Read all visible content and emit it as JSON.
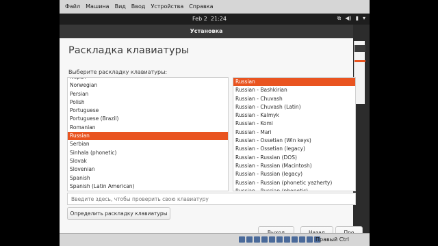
{
  "vbox_menu": [
    "Файл",
    "Машина",
    "Вид",
    "Ввод",
    "Устройства",
    "Справка"
  ],
  "topbar": {
    "date": "Feb 2",
    "time": "21:24",
    "tray_icons": [
      "network-icon",
      "volume-icon",
      "battery-icon",
      "menu-arrow-icon"
    ]
  },
  "window": {
    "title": "Установка"
  },
  "page": {
    "title": "Раскладка клавиатуры",
    "list_label": "Выберите раскладку клавиатуры:"
  },
  "layouts": [
    "Nepali",
    "Norwegian",
    "Persian",
    "Polish",
    "Portuguese",
    "Portuguese (Brazil)",
    "Romanian",
    "Russian",
    "Serbian",
    "Sinhala (phonetic)",
    "Slovak",
    "Slovenian",
    "Spanish",
    "Spanish (Latin American)"
  ],
  "layouts_selected": "Russian",
  "variants": [
    "Russian",
    "Russian - Bashkirian",
    "Russian - Chuvash",
    "Russian - Chuvash (Latin)",
    "Russian - Kalmyk",
    "Russian - Komi",
    "Russian - Mari",
    "Russian - Ossetian (Win keys)",
    "Russian - Ossetian (legacy)",
    "Russian - Russian (DOS)",
    "Russian - Russian (Macintosh)",
    "Russian - Russian (legacy)",
    "Russian - Russian (phonetic yazherty)",
    "Russian - Russian (phonetic)"
  ],
  "variants_selected": "Russian",
  "test_input": {
    "placeholder": "Введите здесь, чтобы проверить свою клавиатуру"
  },
  "buttons": {
    "detect": "Определить раскладку клавиатуры",
    "quit": "Выход",
    "back": "Назад",
    "forward": "Про"
  },
  "statusbar": {
    "host_key": "Правый Ctrl"
  },
  "colors": {
    "accent": "#e95420"
  }
}
